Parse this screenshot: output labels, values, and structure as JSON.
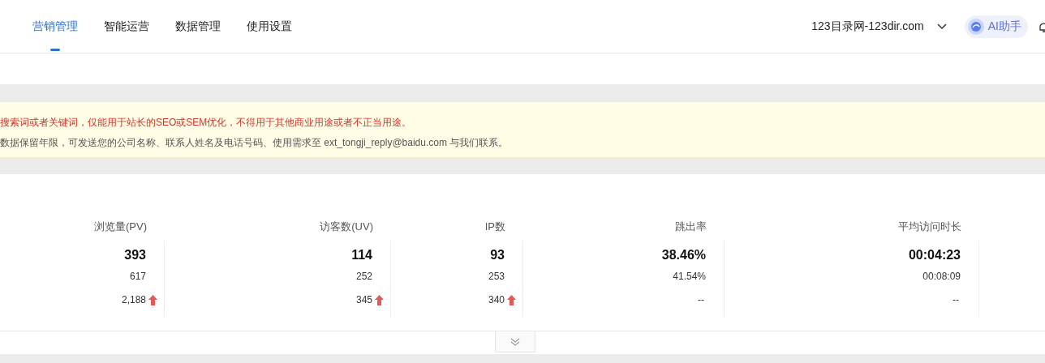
{
  "nav": {
    "tabs": [
      {
        "label": "营销管理",
        "selected": true
      },
      {
        "label": "智能运营",
        "selected": false
      },
      {
        "label": "数据管理",
        "selected": false
      },
      {
        "label": "使用设置",
        "selected": false
      }
    ],
    "site": "123目录网-123dir.com",
    "assistant": "AI助手"
  },
  "notice": {
    "warning": "搜索词或者关键词，仅能用于站长的SEO或SEM优化，不得用于其他商业用途或者不正当用途。",
    "info": "数据保留年限，可发送您的公司名称、联系人姓名及电话号码、使用需求至 ext_tongji_reply@baidu.com 与我们联系。"
  },
  "metrics": [
    {
      "label": "浏览量(PV)",
      "value": "393",
      "row_2": "617",
      "row_3": "2,188",
      "up": true
    },
    {
      "label": "访客数(UV)",
      "value": "114",
      "row_2": "252",
      "row_3": "345",
      "up": true
    },
    {
      "label": "IP数",
      "value": "93",
      "row_2": "253",
      "row_3": "340",
      "up": true
    },
    {
      "label": "跳出率",
      "value": "38.46%",
      "row_2": "41.54%",
      "row_3": "--",
      "up": false
    },
    {
      "label": "平均访问时长",
      "value": "00:04:23",
      "row_2": "00:08:09",
      "row_3": "--",
      "up": false
    }
  ]
}
